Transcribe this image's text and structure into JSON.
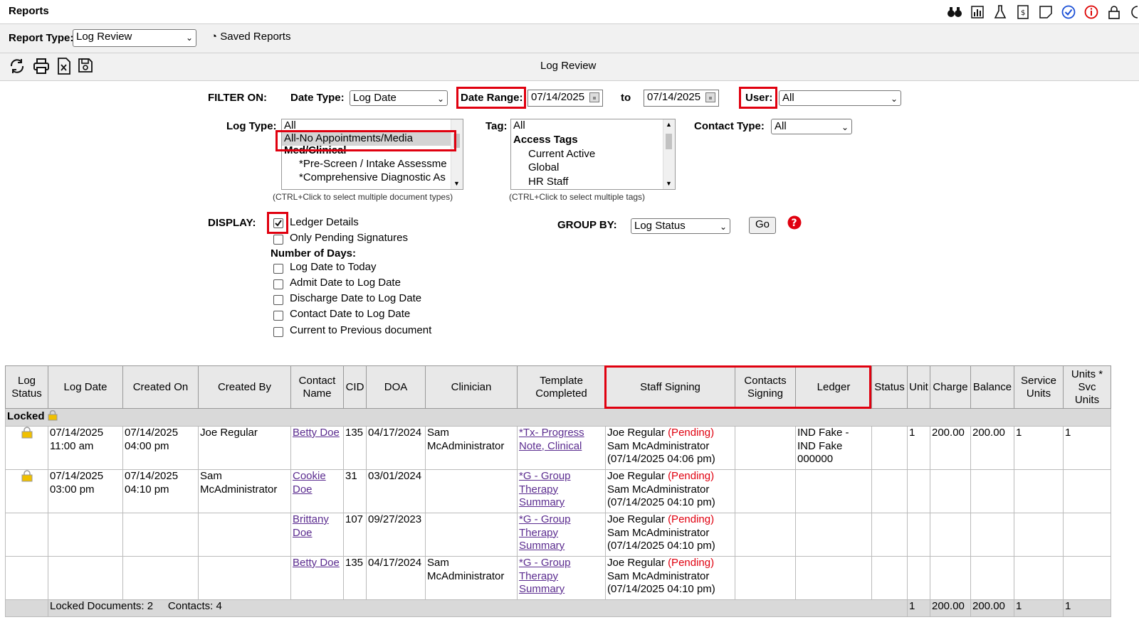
{
  "app": {
    "title": "Reports"
  },
  "toolbar": {
    "report_type_label": "Report Type:",
    "report_type_value": "Log Review",
    "saved_reports": "Saved Reports"
  },
  "report": {
    "title": "Log Review"
  },
  "filter": {
    "filter_on": "FILTER ON:",
    "date_type_label": "Date Type:",
    "date_type_value": "Log Date",
    "date_range_label": "Date Range:",
    "date_from": "07/14/2025",
    "to_label": "to",
    "date_to": "07/14/2025",
    "user_label": "User:",
    "user_value": "All",
    "log_type_label": "Log Type:",
    "log_types": [
      "All",
      "All-No Appointments/Media",
      "Med/Clinical",
      "*Pre-Screen / Intake Assessme",
      "*Comprehensive Diagnostic As"
    ],
    "log_type_hint": "(CTRL+Click to select multiple document types)",
    "tag_label": "Tag:",
    "tags": [
      "All",
      "Access Tags",
      "Current Active",
      "Global",
      "HR Staff"
    ],
    "tag_hint": "(CTRL+Click to select multiple tags)",
    "contact_type_label": "Contact Type:",
    "contact_type_value": "All"
  },
  "display": {
    "label": "DISPLAY:",
    "ledger_details": "Ledger Details",
    "only_pending": "Only Pending Signatures",
    "number_of_days": "Number of Days:",
    "days_options": [
      "Log Date to Today",
      "Admit Date to Log Date",
      "Discharge Date to Log Date",
      "Contact Date to Log Date",
      "Current to Previous document"
    ],
    "group_by_label": "GROUP BY:",
    "group_by_value": "Log Status",
    "go": "Go"
  },
  "table": {
    "headers": [
      "Log Status",
      "Log Date",
      "Created On",
      "Created By",
      "Contact Name",
      "CID",
      "DOA",
      "Clinician",
      "Template Completed",
      "Staff Signing",
      "Contacts Signing",
      "Ledger",
      "Status",
      "Unit",
      "Charge",
      "Balance",
      "Service Units",
      "Units * Svc Units"
    ],
    "group_label": "Locked",
    "rows": [
      {
        "log_date": "07/14/2025 11:00 am",
        "created_on": "07/14/2025 04:00 pm",
        "created_by": "Joe Regular",
        "contact": "Betty Doe",
        "cid": "135",
        "doa": "04/17/2024",
        "clinician": "Sam McAdministrator",
        "template": "*Tx- Progress Note, Clinical",
        "staff": "Joe Regular",
        "pending": "(Pending)",
        "staff2": "Sam McAdministrator",
        "signed": "(07/14/2025 04:06 pm)",
        "ledger": "IND Fake - IND Fake 000000",
        "unit": "1",
        "charge": "200.00",
        "balance": "200.00",
        "service_units": "1",
        "units_svc": "1"
      },
      {
        "log_date": "07/14/2025 03:00 pm",
        "created_on": "07/14/2025 04:10 pm",
        "created_by": "Sam McAdministrator",
        "contact": "Cookie Doe",
        "cid": "31",
        "doa": "03/01/2024",
        "clinician": "",
        "template": "*G - Group Therapy Summary",
        "staff": "Joe Regular",
        "pending": "(Pending)",
        "staff2": "Sam McAdministrator",
        "signed": "(07/14/2025 04:10 pm)",
        "ledger": "",
        "unit": "",
        "charge": "",
        "balance": "",
        "service_units": "",
        "units_svc": ""
      },
      {
        "log_date": "",
        "created_on": "",
        "created_by": "",
        "contact": "Brittany Doe",
        "cid": "107",
        "doa": "09/27/2023",
        "clinician": "",
        "template": "*G - Group Therapy Summary",
        "staff": "Joe Regular",
        "pending": "(Pending)",
        "staff2": "Sam McAdministrator",
        "signed": "(07/14/2025 04:10 pm)",
        "ledger": "",
        "unit": "",
        "charge": "",
        "balance": "",
        "service_units": "",
        "units_svc": ""
      },
      {
        "log_date": "",
        "created_on": "",
        "created_by": "",
        "contact": "Betty Doe",
        "cid": "135",
        "doa": "04/17/2024",
        "clinician": "Sam McAdministrator",
        "template": "*G - Group Therapy Summary",
        "staff": "Joe Regular",
        "pending": "(Pending)",
        "staff2": "Sam McAdministrator",
        "signed": "(07/14/2025 04:10 pm)",
        "ledger": "",
        "unit": "",
        "charge": "",
        "balance": "",
        "service_units": "",
        "units_svc": ""
      }
    ],
    "footer": {
      "locked_docs": "Locked Documents: 2",
      "contacts": "Contacts: 4",
      "unit": "1",
      "charge": "200.00",
      "balance": "200.00",
      "service_units": "1",
      "units_svc": "1"
    }
  },
  "colors": {
    "highlight": "#e0000f",
    "link": "#5b2c8f",
    "pending": "#e0000f"
  }
}
